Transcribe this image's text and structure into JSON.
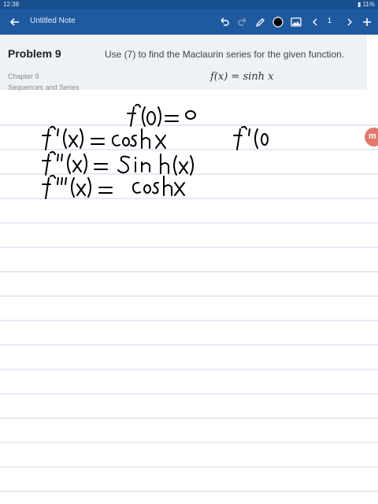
{
  "status_bar": {
    "time": "12:38",
    "battery": "11%"
  },
  "app_bar": {
    "title": "Untitled Note",
    "page_number": "1"
  },
  "problem": {
    "title": "Problem 9",
    "text": "Use (7) to find the Maclaurin series for the given function.",
    "chapter": "Chapter 9",
    "section": "Sequences and Series",
    "formula": "f(x) = sinh x"
  },
  "badge": {
    "letter": "m"
  }
}
